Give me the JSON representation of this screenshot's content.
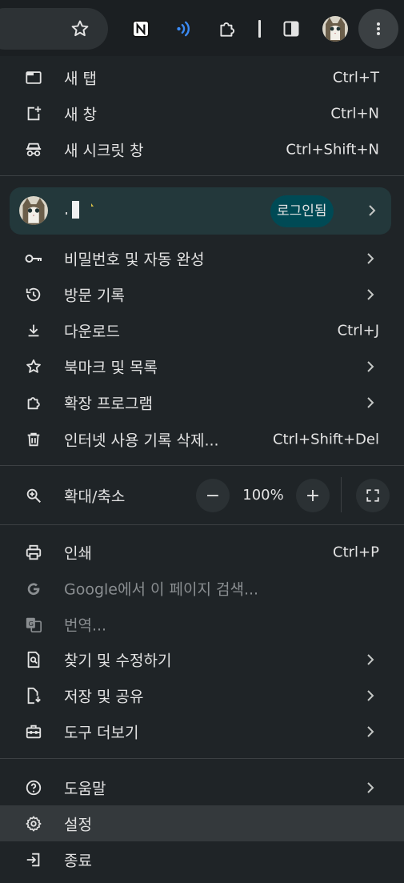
{
  "toolbar": {
    "icons": [
      "bookmark-star-icon",
      "notion-extension-icon",
      "wireless-signal-icon",
      "extensions-puzzle-icon",
      "side-panel-icon",
      "profile-avatar",
      "more-menu-icon"
    ]
  },
  "menu": {
    "group1": [
      {
        "label": "새 탭",
        "shortcut": "Ctrl+T",
        "icon": "new-tab-icon"
      },
      {
        "label": "새 창",
        "shortcut": "Ctrl+N",
        "icon": "new-window-icon"
      },
      {
        "label": "새 시크릿 창",
        "shortcut": "Ctrl+Shift+N",
        "icon": "incognito-icon"
      }
    ],
    "profile": {
      "badge": "로그인됨"
    },
    "group2": [
      {
        "label": "비밀번호 및 자동 완성",
        "icon": "key-icon",
        "submenu": true
      },
      {
        "label": "방문 기록",
        "icon": "history-icon",
        "submenu": true
      },
      {
        "label": "다운로드",
        "shortcut": "Ctrl+J",
        "icon": "download-icon"
      },
      {
        "label": "북마크 및 목록",
        "icon": "star-icon",
        "submenu": true
      },
      {
        "label": "확장 프로그램",
        "icon": "puzzle-icon",
        "submenu": true
      },
      {
        "label": "인터넷 사용 기록 삭제...",
        "shortcut": "Ctrl+Shift+Del",
        "icon": "trash-icon"
      }
    ],
    "zoom": {
      "label": "확대/축소",
      "minus": "−",
      "value": "100%",
      "plus": "+"
    },
    "group3": [
      {
        "label": "인쇄",
        "shortcut": "Ctrl+P",
        "icon": "print-icon"
      },
      {
        "label": "Google에서 이 페이지 검색...",
        "icon": "google-g-icon",
        "disabled": true
      },
      {
        "label": "번역...",
        "icon": "translate-icon",
        "disabled": true
      },
      {
        "label": "찾기 및 수정하기",
        "icon": "find-icon",
        "submenu": true
      },
      {
        "label": "저장 및 공유",
        "icon": "save-share-icon",
        "submenu": true
      },
      {
        "label": "도구 더보기",
        "icon": "toolbox-icon",
        "submenu": true
      }
    ],
    "group4": [
      {
        "label": "도움말",
        "icon": "help-icon",
        "submenu": true
      },
      {
        "label": "설정",
        "icon": "settings-gear-icon",
        "highlighted": true
      },
      {
        "label": "종료",
        "icon": "exit-icon"
      }
    ]
  },
  "colors": {
    "background": "#1f2427",
    "text": "#e3e3e3",
    "disabled_text": "#8a8e91",
    "profile_row": "#23383b",
    "badge": "#004a55",
    "accent_blue": "#3b8bf6"
  }
}
